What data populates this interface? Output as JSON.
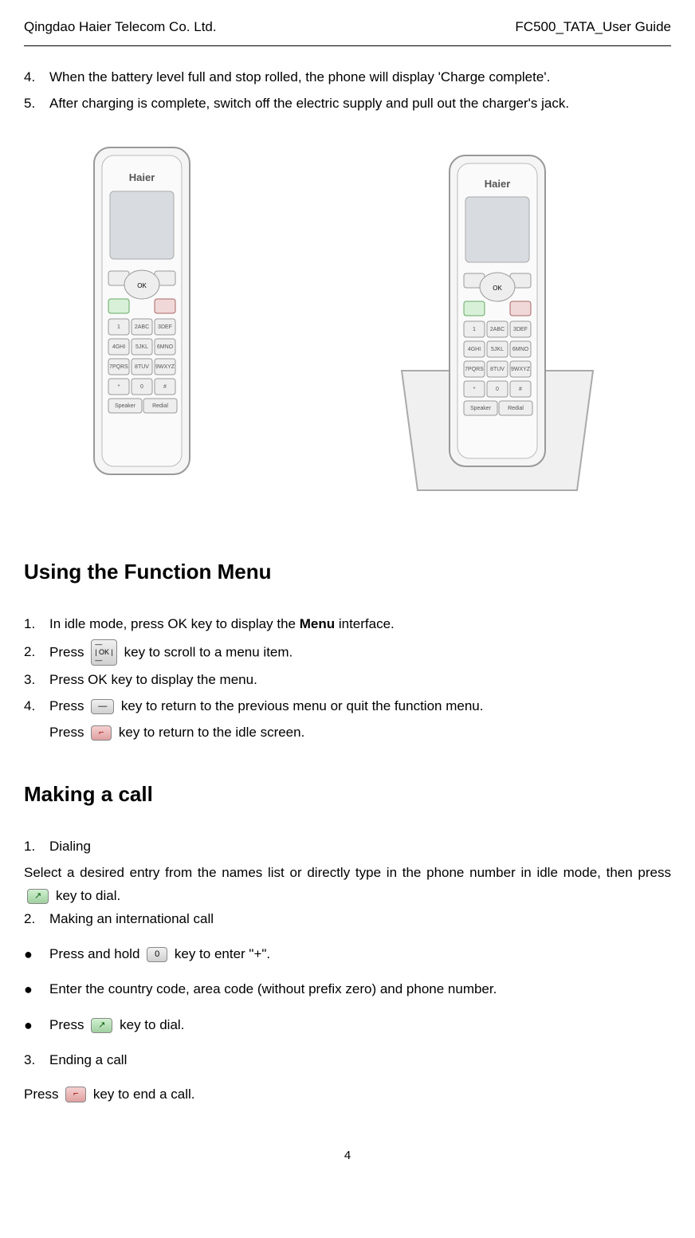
{
  "header": {
    "left": "Qingdao Haier Telecom Co. Ltd.",
    "right": "FC500_TATA_User Guide"
  },
  "charging_steps": [
    {
      "num": "4.",
      "text": "When the battery level full and stop rolled, the phone will display 'Charge complete'."
    },
    {
      "num": "5.",
      "text": "After charging is complete, switch off the electric supply and pull out the charger's jack."
    }
  ],
  "section_function_menu": {
    "title": "Using the Function Menu",
    "steps": [
      {
        "num": "1.",
        "text_before": "In idle mode, press OK key to display the ",
        "bold": "Menu",
        "text_after": " interface."
      },
      {
        "num": "2.",
        "text_before": "Press ",
        "icon": "nav",
        "text_after": " key to scroll to a menu item."
      },
      {
        "num": "3.",
        "text": "Press OK key to display the menu."
      },
      {
        "num": "4.",
        "text_before": "Press ",
        "icon": "back",
        "text_after": " key to return to the previous menu or quit the function menu."
      },
      {
        "indent": true,
        "text_before": "Press ",
        "icon": "end",
        "text_after": " key to return to the idle screen."
      }
    ]
  },
  "section_making_call": {
    "title": "Making a call",
    "items": [
      {
        "num": "1.",
        "text": "Dialing"
      },
      {
        "para_before": "Select a desired entry from the names list or directly type in the phone number in idle mode, then press ",
        "icon": "call",
        "para_after": " key to dial."
      },
      {
        "num": "2.",
        "text": "Making an international call"
      },
      {
        "bullet": true,
        "text_before": "Press and hold ",
        "icon": "zero",
        "text_after": " key to enter \"+\"."
      },
      {
        "bullet": true,
        "text": "Enter the country code, area code (without prefix zero) and phone number."
      },
      {
        "bullet": true,
        "text_before": "Press ",
        "icon": "call",
        "text_after": " key to dial."
      },
      {
        "num": "3.",
        "text": "Ending a call"
      },
      {
        "para_before": "Press ",
        "icon": "end",
        "para_after": " key to end a call."
      }
    ]
  },
  "page_number": "4",
  "icons": {
    "nav_label": "OK",
    "zero_label": "0",
    "call_symbol": "↗",
    "end_symbol": "⌐",
    "back_symbol": "—"
  }
}
